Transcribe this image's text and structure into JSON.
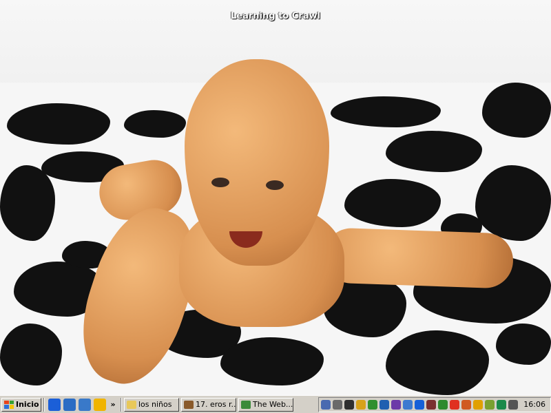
{
  "desktop": {
    "wallpaper_title": "Learning to Crawl"
  },
  "taskbar": {
    "start_label": "Inicio",
    "quick_launch": [
      {
        "icon": "internet-explorer-icon",
        "color": "#1b5fd8"
      },
      {
        "icon": "show-desktop-icon",
        "color": "#2a6cc4"
      },
      {
        "icon": "outlook-express-icon",
        "color": "#3979c9"
      },
      {
        "icon": "media-player-icon",
        "color": "#f0b400"
      }
    ],
    "chevron": "»",
    "tasks": [
      {
        "label": "los niños",
        "icon": "folder-icon",
        "color": "#e8c85a"
      },
      {
        "label": "17. eros r...",
        "icon": "media-icon",
        "color": "#8a5a2a"
      },
      {
        "label": "The Web...",
        "icon": "web-page-icon",
        "color": "#3a8a3a"
      }
    ],
    "tray_icons": [
      {
        "icon": "network-icon",
        "color": "#4a6ab0"
      },
      {
        "icon": "printer-icon",
        "color": "#6a6a6a"
      },
      {
        "icon": "antivirus-icon",
        "color": "#2f2f2f"
      },
      {
        "icon": "pencil-icon",
        "color": "#d7a21b"
      },
      {
        "icon": "green-app-icon",
        "color": "#2f8f2f"
      },
      {
        "icon": "blue-app-icon",
        "color": "#2060b0"
      },
      {
        "icon": "monitor-icon",
        "color": "#6c3aa8"
      },
      {
        "icon": "users-icon",
        "color": "#3c7ad0"
      },
      {
        "icon": "eye-icon",
        "color": "#1560d8"
      },
      {
        "icon": "camera-icon",
        "color": "#7a3030"
      },
      {
        "icon": "chart-icon",
        "color": "#2d8a2d"
      },
      {
        "icon": "lightning-icon",
        "color": "#e03020"
      },
      {
        "icon": "messenger-icon",
        "color": "#d05a20"
      },
      {
        "icon": "lock-icon",
        "color": "#e0a000"
      },
      {
        "icon": "speaker-icon",
        "color": "#7aa030"
      },
      {
        "icon": "globe-icon",
        "color": "#1a8a4a"
      },
      {
        "icon": "shield-icon",
        "color": "#555555"
      }
    ],
    "clock": "16:06"
  }
}
